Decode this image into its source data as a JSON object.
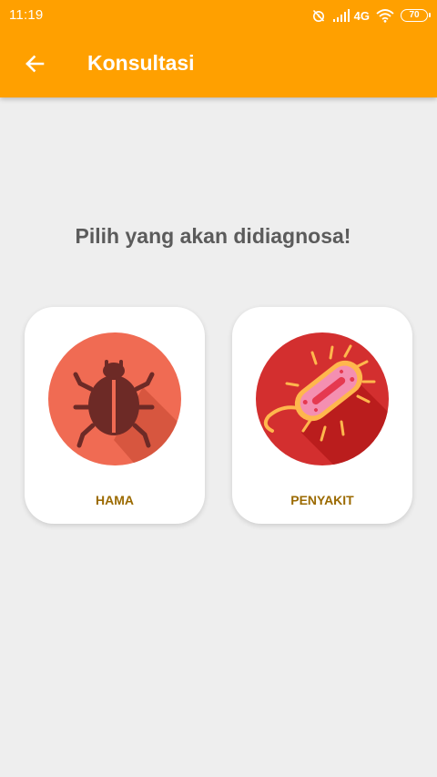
{
  "status_bar": {
    "time": "11:19",
    "network": "4G",
    "battery": "70"
  },
  "app_bar": {
    "title": "Konsultasi",
    "back_icon": "arrow-left-icon"
  },
  "main": {
    "heading": "Pilih yang akan didiagnosa!",
    "options": [
      {
        "label": "HAMA",
        "icon": "bug-icon"
      },
      {
        "label": "PENYAKIT",
        "icon": "bacteria-icon"
      }
    ]
  },
  "colors": {
    "app_bar": "#ffa000",
    "background": "#eeeeee",
    "heading": "#5b5b5b",
    "card_label": "#9b6a00",
    "bug_circle": "#f06b53",
    "bacteria_circle": "#d32f2f"
  }
}
